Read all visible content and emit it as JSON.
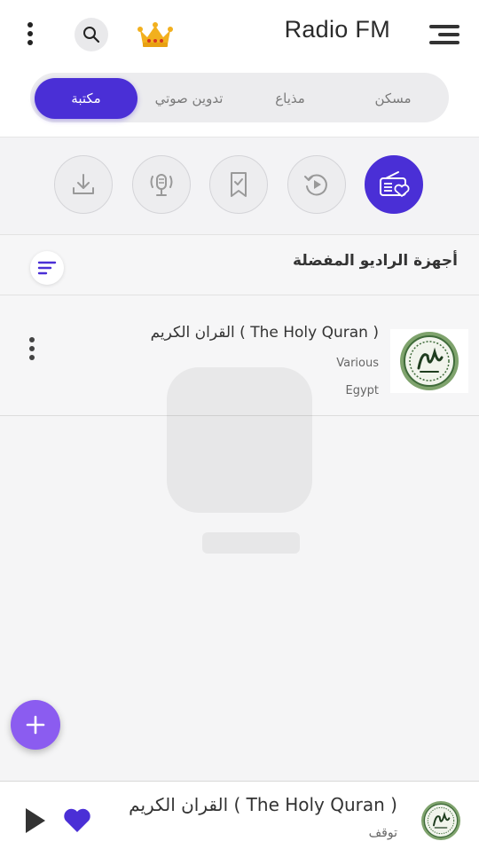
{
  "header": {
    "app_title": "Radio FM"
  },
  "tabs": [
    {
      "label": "مكتبة",
      "active": true
    },
    {
      "label": "تدوين صوتي",
      "active": false
    },
    {
      "label": "مذياع",
      "active": false
    },
    {
      "label": "مسكن",
      "active": false
    }
  ],
  "category_icons": [
    {
      "icon": "download-icon",
      "active": false
    },
    {
      "icon": "podcast-microphone-icon",
      "active": false
    },
    {
      "icon": "bookmark-icon",
      "active": false
    },
    {
      "icon": "history-icon",
      "active": false
    },
    {
      "icon": "radio-favorite-icon",
      "active": true
    }
  ],
  "section": {
    "title": "أجهزة الراديو المفضلة"
  },
  "stations": [
    {
      "title": "القران الكريم ( The Holy Quran )",
      "genre": "Various",
      "country": "Egypt"
    }
  ],
  "player": {
    "title": "القران الكريم ( The Holy Quran )",
    "status": "توقف"
  },
  "colors": {
    "accent": "#4a2fd6",
    "fab": "#8b5cf0",
    "crown": "#f2b01e"
  }
}
